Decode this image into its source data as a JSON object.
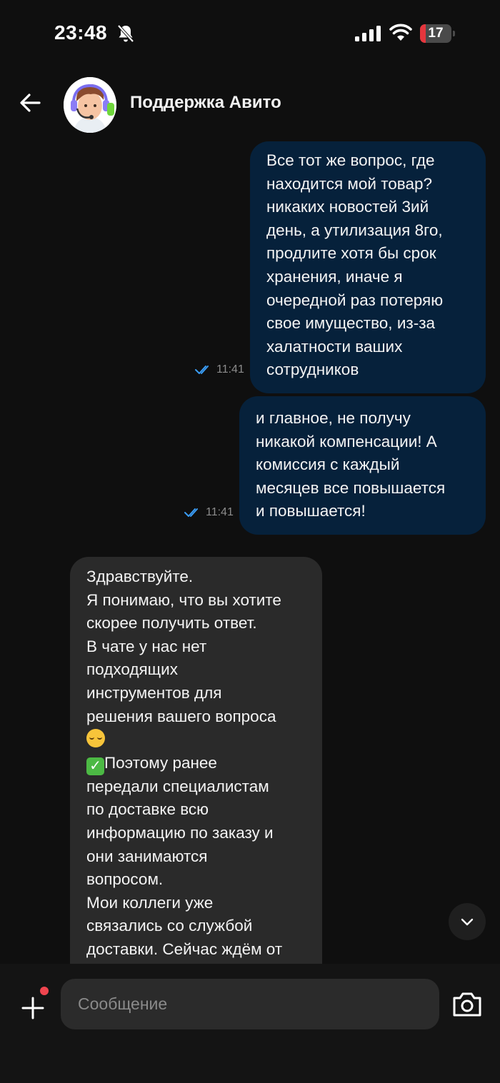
{
  "status_bar": {
    "time": "23:48",
    "battery_level": "17",
    "icons": [
      "bell-off-icon",
      "signal-icon",
      "wifi-icon",
      "battery-icon"
    ],
    "battery_color": "#e5363d"
  },
  "header": {
    "title": "Поддержка Авито",
    "back_icon": "arrow-left-icon",
    "avatar": "support-agent-avatar"
  },
  "messages": [
    {
      "direction": "outgoing",
      "text": "Все тот же вопрос, где\nнаходится мой товар?\nникаких новостей 3ий\nдень, а утилизация 8го,\nпродлите хотя бы срок\nхранения, иначе я\nочередной раз потеряю\nсвое имущество, из-за\nхалатности ваших\nсотрудников",
      "time": "11:41",
      "status": "read"
    },
    {
      "direction": "outgoing",
      "text": "и главное, не получу\nникакой компенсации! А\nкомиссия с каждый\nмесяцев все повышается\nи повышается!",
      "time": "11:41",
      "status": "read"
    },
    {
      "direction": "incoming",
      "part1": "Здравствуйте.\nЯ понимаю, что вы хотите\nскорее получить ответ.\nВ чате у нас нет\nподходящих\nинструментов для\nрешения вашего вопроса",
      "emoji1": "pensive-face",
      "emoji2": "check-mark-button",
      "part2": "Поэтому ранее\nпередали специалистам\nпо доставке всю\nинформацию по заказу и\nони занимаются\nвопросом.\nМои коллеги уже\nсвязались со службой\nдоставки. Сейчас ждём от"
    }
  ],
  "input": {
    "placeholder": "Сообщение"
  },
  "colors": {
    "background": "#0f0f0f",
    "outgoing_bubble": "#06213b",
    "incoming_bubble": "#2a2a2a",
    "read_ticks": "#3a9cf5",
    "notification_dot": "#f0454f"
  }
}
